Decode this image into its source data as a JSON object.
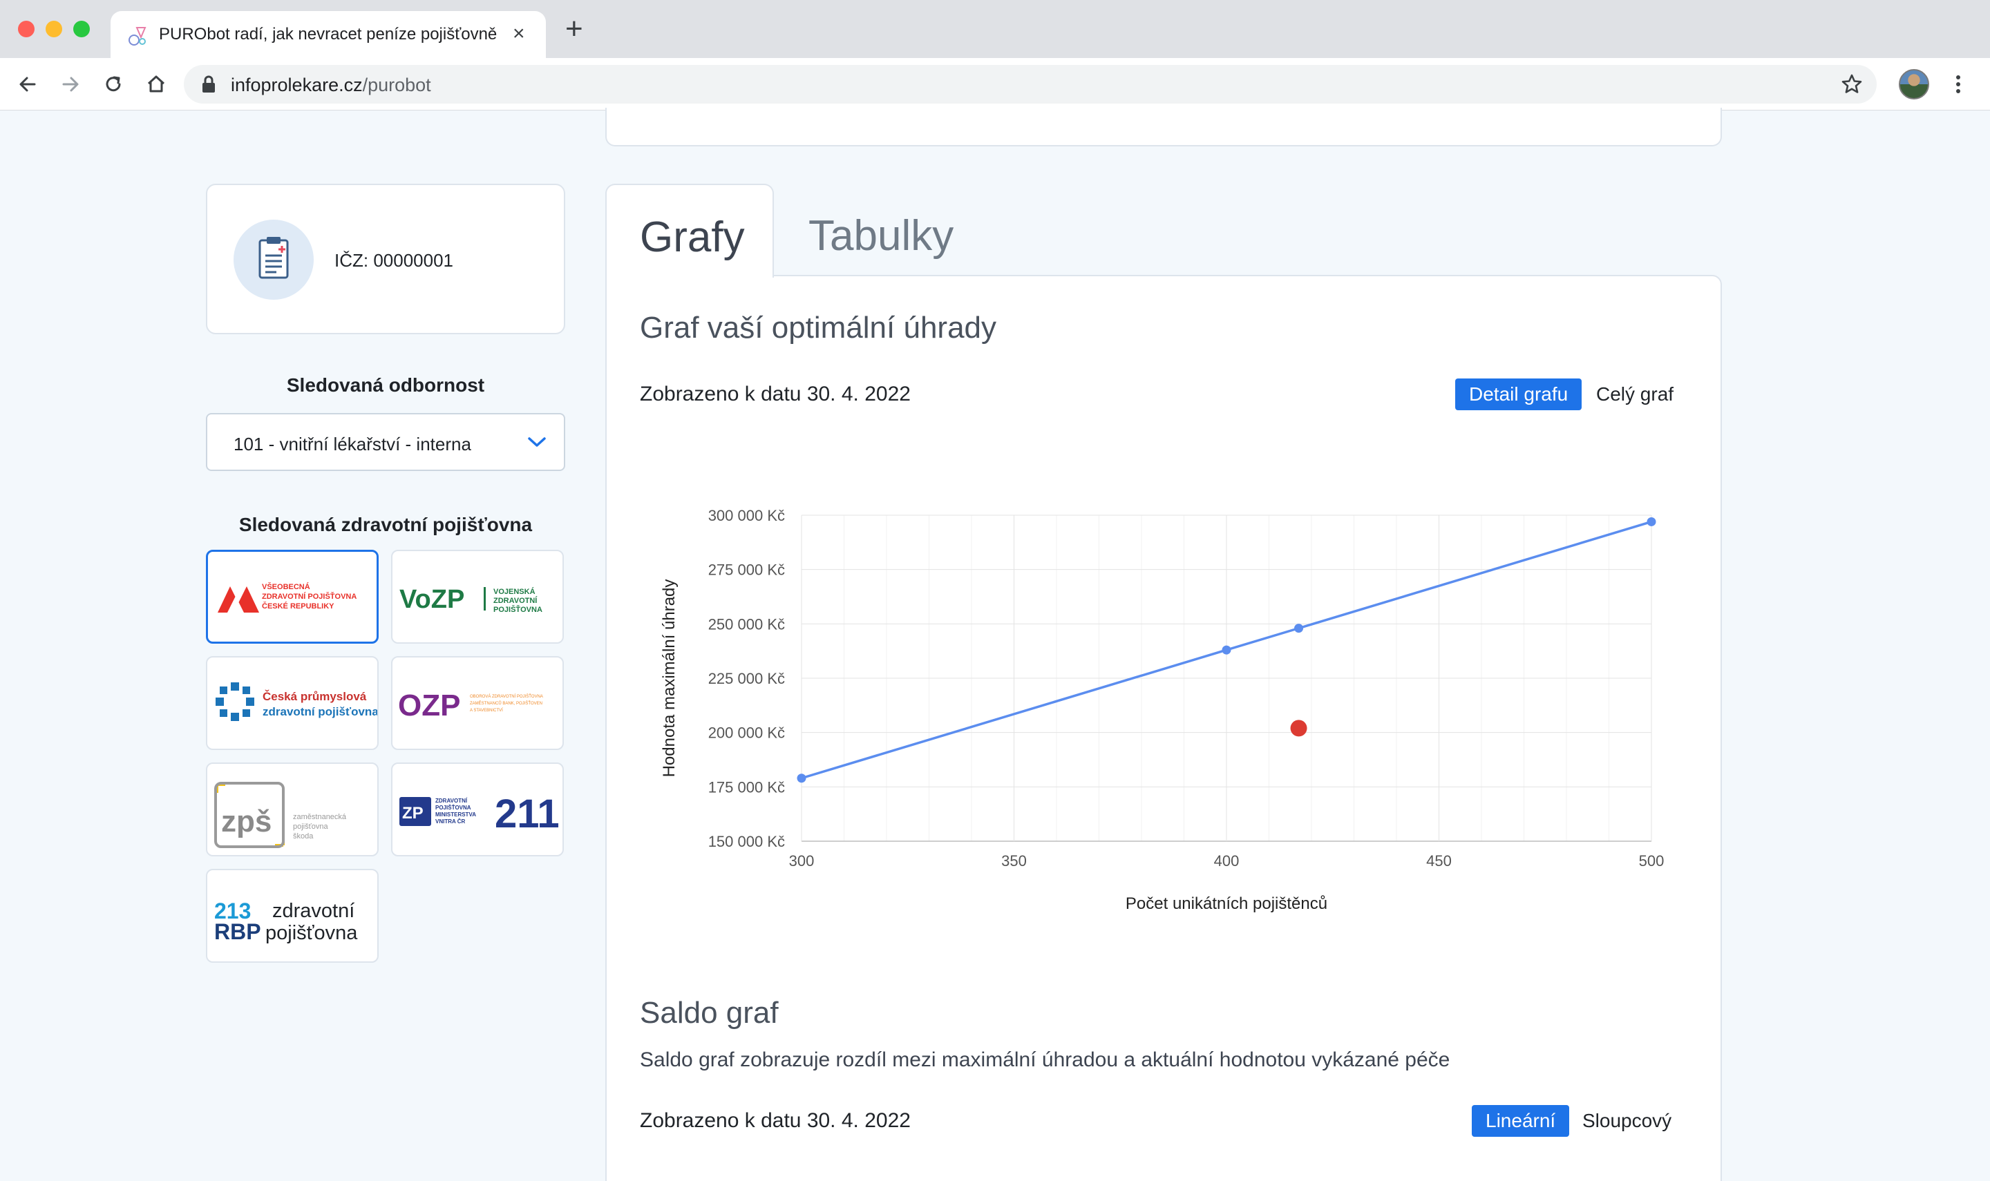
{
  "browser": {
    "tab_title": "PURObot radí, jak nevracet peníze pojišťovně",
    "url_host": "infoprolekare.cz",
    "url_path": "/purobot"
  },
  "sidebar": {
    "icz_label": "IČZ: 00000001",
    "specialty_heading": "Sledovaná odbornost",
    "specialty_value": "101 - vnitřní lékařství - interna",
    "insurer_heading": "Sledovaná zdravotní pojišťovna",
    "insurers": [
      {
        "code": "VZP",
        "lines": [
          "VŠEOBECNÁ",
          "ZDRAVOTNÍ POJIŠŤOVNA",
          "ČESKÉ REPUBLIKY"
        ],
        "color": "#e8312a",
        "selected": true
      },
      {
        "code": "VoZP",
        "lines": [
          "VOJENSKÁ",
          "ZDRAVOTNÍ",
          "POJIŠŤOVNA"
        ],
        "color": "#1e7a45",
        "selected": false
      },
      {
        "code": "ČPZP",
        "lines": [
          "Česká průmyslová",
          "zdravotní pojišťovna"
        ],
        "color": "#1b74b8",
        "selected": false
      },
      {
        "code": "OZP",
        "lines": [
          "OBOROVÁ ZDRAVOTNÍ POJIŠŤOVNA",
          "ZAMĚSTNANCŮ BANK, POJIŠŤOVEN",
          "A STAVEBNICTVÍ"
        ],
        "color": "#7a2a8c",
        "selected": false
      },
      {
        "code": "zpš",
        "lines": [
          "zaměstnanecká",
          "pojišťovna",
          "škoda"
        ],
        "color": "#8a8a8a",
        "selected": false
      },
      {
        "code": "211",
        "lines": [
          "ZDRAVOTNÍ",
          "POJIŠŤOVNA",
          "MINISTERSTVA",
          "VNITRA ČR"
        ],
        "color": "#233a8c",
        "selected": false
      },
      {
        "code": "213",
        "lines": [
          "zdravotní",
          "pojišťovna"
        ],
        "color": "#1b74b8",
        "selected": false
      }
    ]
  },
  "tabs": {
    "grafy": "Grafy",
    "tabulky": "Tabulky"
  },
  "graph_section": {
    "title": "Graf vaší optimální úhrady",
    "date_text": "Zobrazeno k datu 30. 4. 2022",
    "btn_detail": "Detail grafu",
    "btn_full": "Celý graf"
  },
  "saldo_section": {
    "title": "Saldo graf",
    "description": "Saldo graf zobrazuje rozdíl mezi maximální úhradou a aktuální hodnotou vykázané péče",
    "date_text": "Zobrazeno k datu 30. 4. 2022",
    "btn_linear": "Lineární",
    "btn_bar": "Sloupcový"
  },
  "colors": {
    "accent": "#1e73e8",
    "line": "#5b8def",
    "point_red": "#dc3b32"
  },
  "chart_data": {
    "type": "line",
    "xlabel": "Počet unikátních pojištěnců",
    "ylabel": "Hodnota maximální úhrady",
    "xlim": [
      300,
      500
    ],
    "ylim": [
      150000,
      300000
    ],
    "x_ticks": [
      300,
      350,
      400,
      450,
      500
    ],
    "x_tick_labels": [
      "300",
      "350",
      "400",
      "450",
      "500"
    ],
    "y_ticks": [
      150000,
      175000,
      200000,
      225000,
      250000,
      275000,
      300000
    ],
    "y_tick_labels": [
      "150 000 Kč",
      "175 000 Kč",
      "200 000 Kč",
      "225 000 Kč",
      "250 000 Kč",
      "275 000 Kč",
      "300 000 Kč"
    ],
    "grid": true,
    "series": [
      {
        "x": [
          300,
          400,
          417,
          500
        ],
        "y": [
          179000,
          238000,
          248000,
          297000
        ],
        "color": "#5b8def"
      }
    ],
    "highlight_points": [
      {
        "x": 417,
        "y": 202000,
        "color": "#dc3b32"
      }
    ]
  }
}
